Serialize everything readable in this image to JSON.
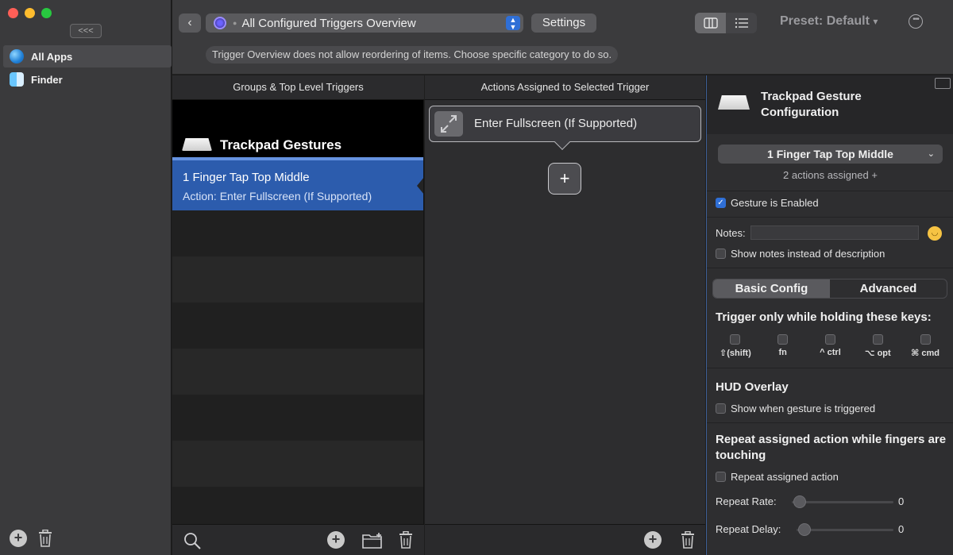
{
  "sidebar": {
    "collapse_label": "<<<",
    "items": [
      {
        "label": "All Apps",
        "icon": "globe-icon",
        "selected": true
      },
      {
        "label": "Finder",
        "icon": "finder-icon",
        "selected": false
      }
    ]
  },
  "toolbar": {
    "back_icon": "chevron-left-icon",
    "trigger_select_value": "All Configured Triggers Overview",
    "settings_label": "Settings",
    "preset_label": "Preset: Default",
    "preset_caret": "▾",
    "notice": "Trigger Overview does not allow reordering of items. Choose specific category to do so."
  },
  "columns": {
    "groups_header": "Groups & Top Level Triggers",
    "actions_header": "Actions Assigned to Selected Trigger"
  },
  "groups": {
    "group_name": "Trackpad Gestures",
    "selected_trigger": {
      "title": "1 Finger Tap Top Middle",
      "subtitle": "Action: Enter Fullscreen (If Supported)"
    }
  },
  "actions": {
    "items": [
      {
        "label": "Enter Fullscreen (If Supported)",
        "icon": "fullscreen-icon"
      }
    ],
    "add_label": "+"
  },
  "config": {
    "title": "Trackpad Gesture Configuration",
    "trigger_dropdown_value": "1 Finger Tap Top Middle",
    "assigned_text": "2 actions assigned +",
    "gesture_enabled_label": "Gesture is Enabled",
    "gesture_enabled": true,
    "notes_label": "Notes:",
    "notes_value": "",
    "show_notes_label": "Show notes instead of description",
    "tabs": [
      {
        "label": "Basic Config",
        "selected": true
      },
      {
        "label": "Advanced",
        "selected": false
      }
    ],
    "keys_title": "Trigger only while holding these keys:",
    "keys": [
      "⇧(shift)",
      "fn",
      "^ ctrl",
      "⌥ opt",
      "⌘ cmd"
    ],
    "hud_title": "HUD Overlay",
    "hud_checkbox_label": "Show when gesture is triggered",
    "repeat_title": "Repeat assigned action while fingers are touching",
    "repeat_checkbox_label": "Repeat assigned action",
    "repeat_rate_label": "Repeat Rate:",
    "repeat_rate_value": "0",
    "repeat_delay_label": "Repeat Delay:",
    "repeat_delay_value": "0"
  },
  "colors": {
    "accent": "#2f6fd6",
    "selection": "#2c5cad",
    "panel": "#2e2e30"
  }
}
